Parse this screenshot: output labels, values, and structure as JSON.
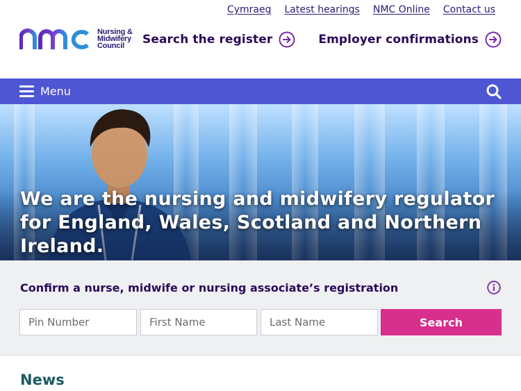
{
  "utility_links": [
    "Cymraeg",
    "Latest hearings",
    "NMC Online",
    "Contact us"
  ],
  "logo": {
    "mark": "nmc",
    "lines": [
      "Nursing &",
      "Midwifery",
      "Council"
    ]
  },
  "header": {
    "search_register": "Search the register",
    "employer_confirmations": "Employer confirmations"
  },
  "menu": {
    "label": "Menu"
  },
  "hero": {
    "heading": "We are the nursing and midwifery regulator for England, Wales, Scotland and Northern Ireland."
  },
  "register_check": {
    "title": "Confirm a nurse, midwife or nursing associate’s registration",
    "pin_placeholder": "Pin Number",
    "first_name_placeholder": "First Name",
    "last_name_placeholder": "Last Name",
    "search_label": "Search"
  },
  "news": {
    "heading": "News"
  },
  "colors": {
    "brand_purple": "#2b0a57",
    "menu_bar": "#4f56d4",
    "search_button": "#d62f8c",
    "news_heading": "#1d5a63",
    "panel_bg": "#eef0f2"
  },
  "icons": [
    "hamburger-icon",
    "search-icon",
    "arrow-circle-right-icon",
    "info-icon"
  ]
}
